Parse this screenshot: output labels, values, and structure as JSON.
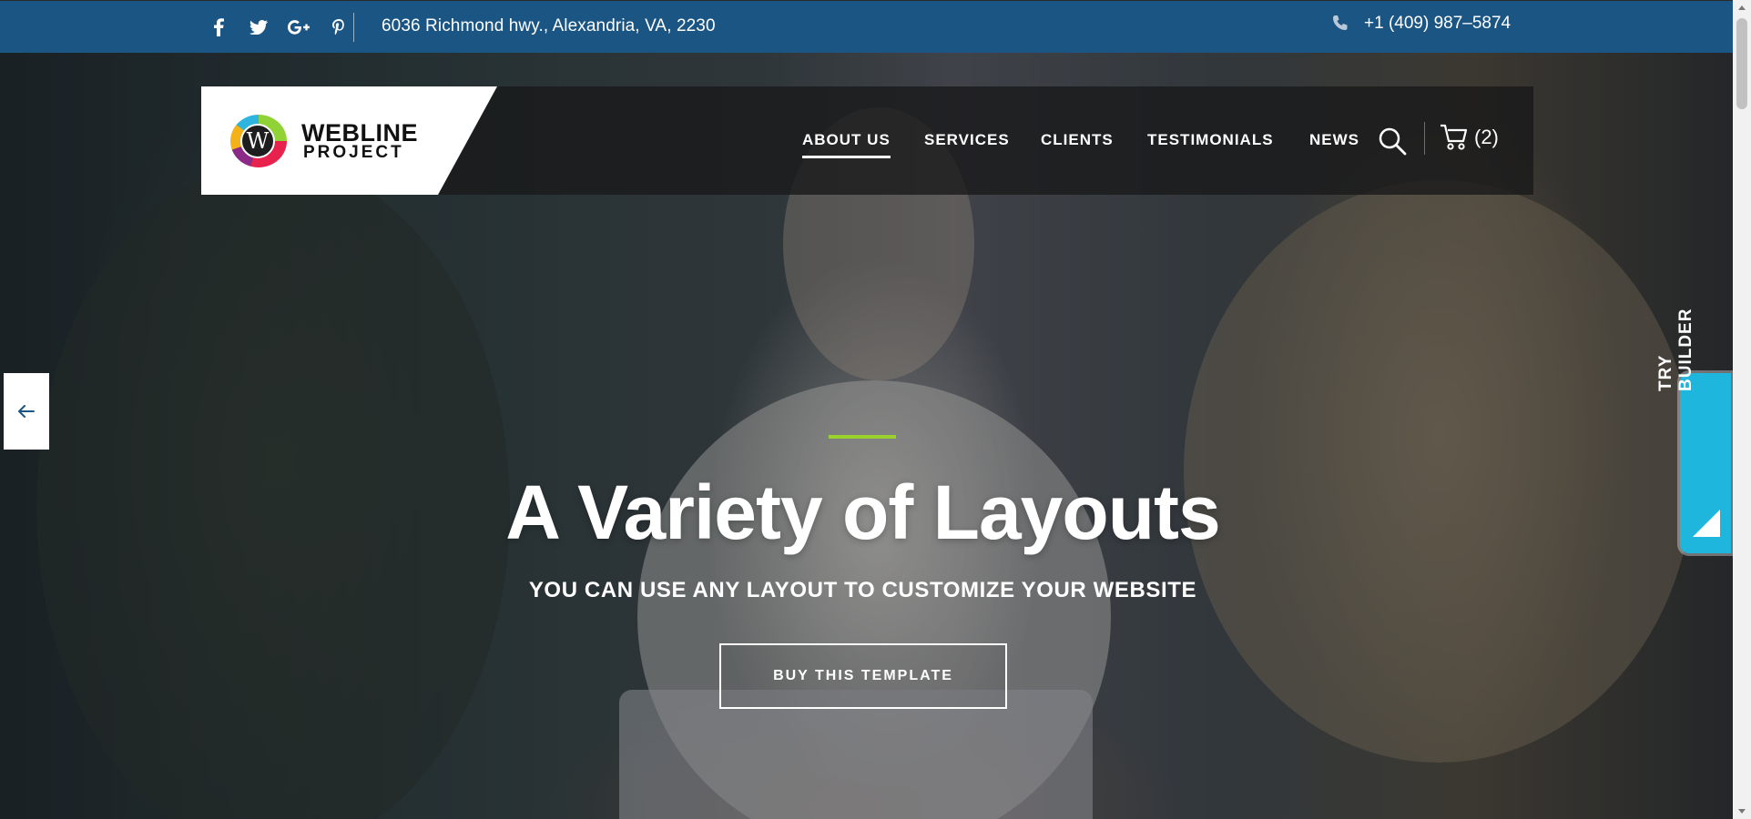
{
  "topbar": {
    "social": [
      {
        "name": "facebook",
        "glyph": "f"
      },
      {
        "name": "twitter",
        "glyph": "t"
      },
      {
        "name": "google-plus",
        "glyph": "G+"
      },
      {
        "name": "pinterest",
        "glyph": "p"
      }
    ],
    "address": "6036 Richmond hwy., Alexandria, VA, 2230",
    "phone": "+1 (409) 987–5874",
    "background": "#1b5584"
  },
  "logo": {
    "mark_letter": "W",
    "line1": "WEBLINE",
    "line2": "PROJECT"
  },
  "nav": {
    "items": [
      {
        "label": "ABOUT US",
        "active": true
      },
      {
        "label": "SERVICES",
        "active": false
      },
      {
        "label": "CLIENTS",
        "active": false
      },
      {
        "label": "TESTIMONIALS",
        "active": false
      },
      {
        "label": "NEWS",
        "active": false
      }
    ],
    "cart_count": "(2)"
  },
  "hero": {
    "title": "A Variety of Layouts",
    "subtitle": "YOU CAN USE ANY LAYOUT TO CUSTOMIZE YOUR WEBSITE",
    "button_label": "BUY THIS TEMPLATE",
    "accent_color": "#9bd12c"
  },
  "side": {
    "try_builder_label": "TRY BUILDER",
    "try_builder_color": "#1fb6dd"
  }
}
